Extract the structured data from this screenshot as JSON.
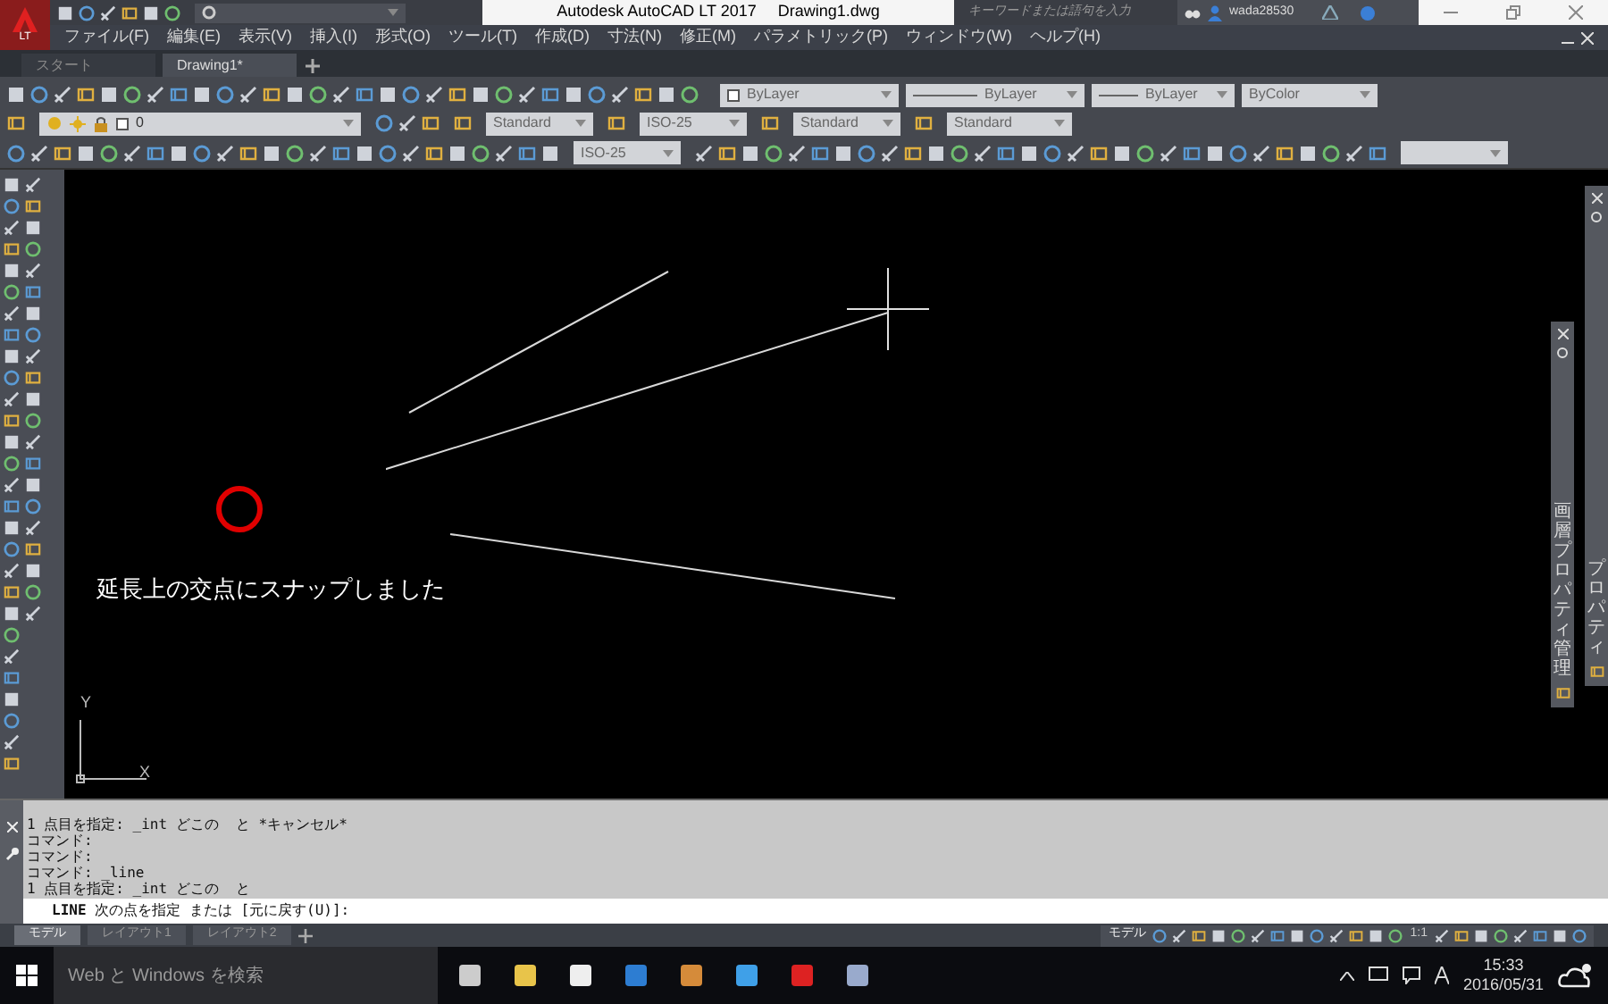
{
  "title_bar": {
    "logo_badge": "LT",
    "title": "Autodesk AutoCAD LT 2017",
    "file": "Drawing1.dwg",
    "search_placeholder": "キーワードまたは語句を入力",
    "user": "wada28530"
  },
  "menu": [
    "ファイル(F)",
    "編集(E)",
    "表示(V)",
    "挿入(I)",
    "形式(O)",
    "ツール(T)",
    "作成(D)",
    "寸法(N)",
    "修正(M)",
    "パラメトリック(P)",
    "ウィンドウ(W)",
    "ヘルプ(H)"
  ],
  "file_tabs": [
    {
      "label": "スタート",
      "selected": false
    },
    {
      "label": "Drawing1*",
      "selected": true
    }
  ],
  "properties": {
    "row_1": [
      {
        "kind": "color",
        "label": "ByLayer"
      },
      {
        "kind": "linetype",
        "label": "ByLayer"
      },
      {
        "kind": "lineweight",
        "label": "ByLayer"
      },
      {
        "kind": "plotstyle",
        "label": "ByColor"
      }
    ],
    "layer": "0",
    "text_style": "Standard",
    "dim_style": "ISO-25",
    "table_style": "Standard",
    "multileader_style": "Standard",
    "dim_style_2": "ISO-25"
  },
  "canvas": {
    "message": "延長上の交点にスナップしました",
    "ucs_x": "X",
    "ucs_y": "Y"
  },
  "palettes": [
    {
      "title": "プロパティ"
    },
    {
      "title": "画層プロパティ管理"
    }
  ],
  "command": {
    "history": [
      "1 点目を指定: _int どこの  と *キャンセル*",
      "コマンド:",
      "コマンド:",
      "コマンド: _line",
      "1 点目を指定: _int どこの  と"
    ],
    "prompt": "**LINE** 次の点を指定 または [元に戻す(U)]:"
  },
  "layout_tabs": [
    {
      "label": "モデル",
      "selected": true
    },
    {
      "label": "レイアウト1",
      "selected": false
    },
    {
      "label": "レイアウト2",
      "selected": false
    }
  ],
  "status_bar": {
    "space": "モデル",
    "scale": "1:1"
  },
  "taskbar": {
    "search_placeholder": "Web と Windows を検索",
    "time": "15:33",
    "date": "2016/05/31"
  }
}
